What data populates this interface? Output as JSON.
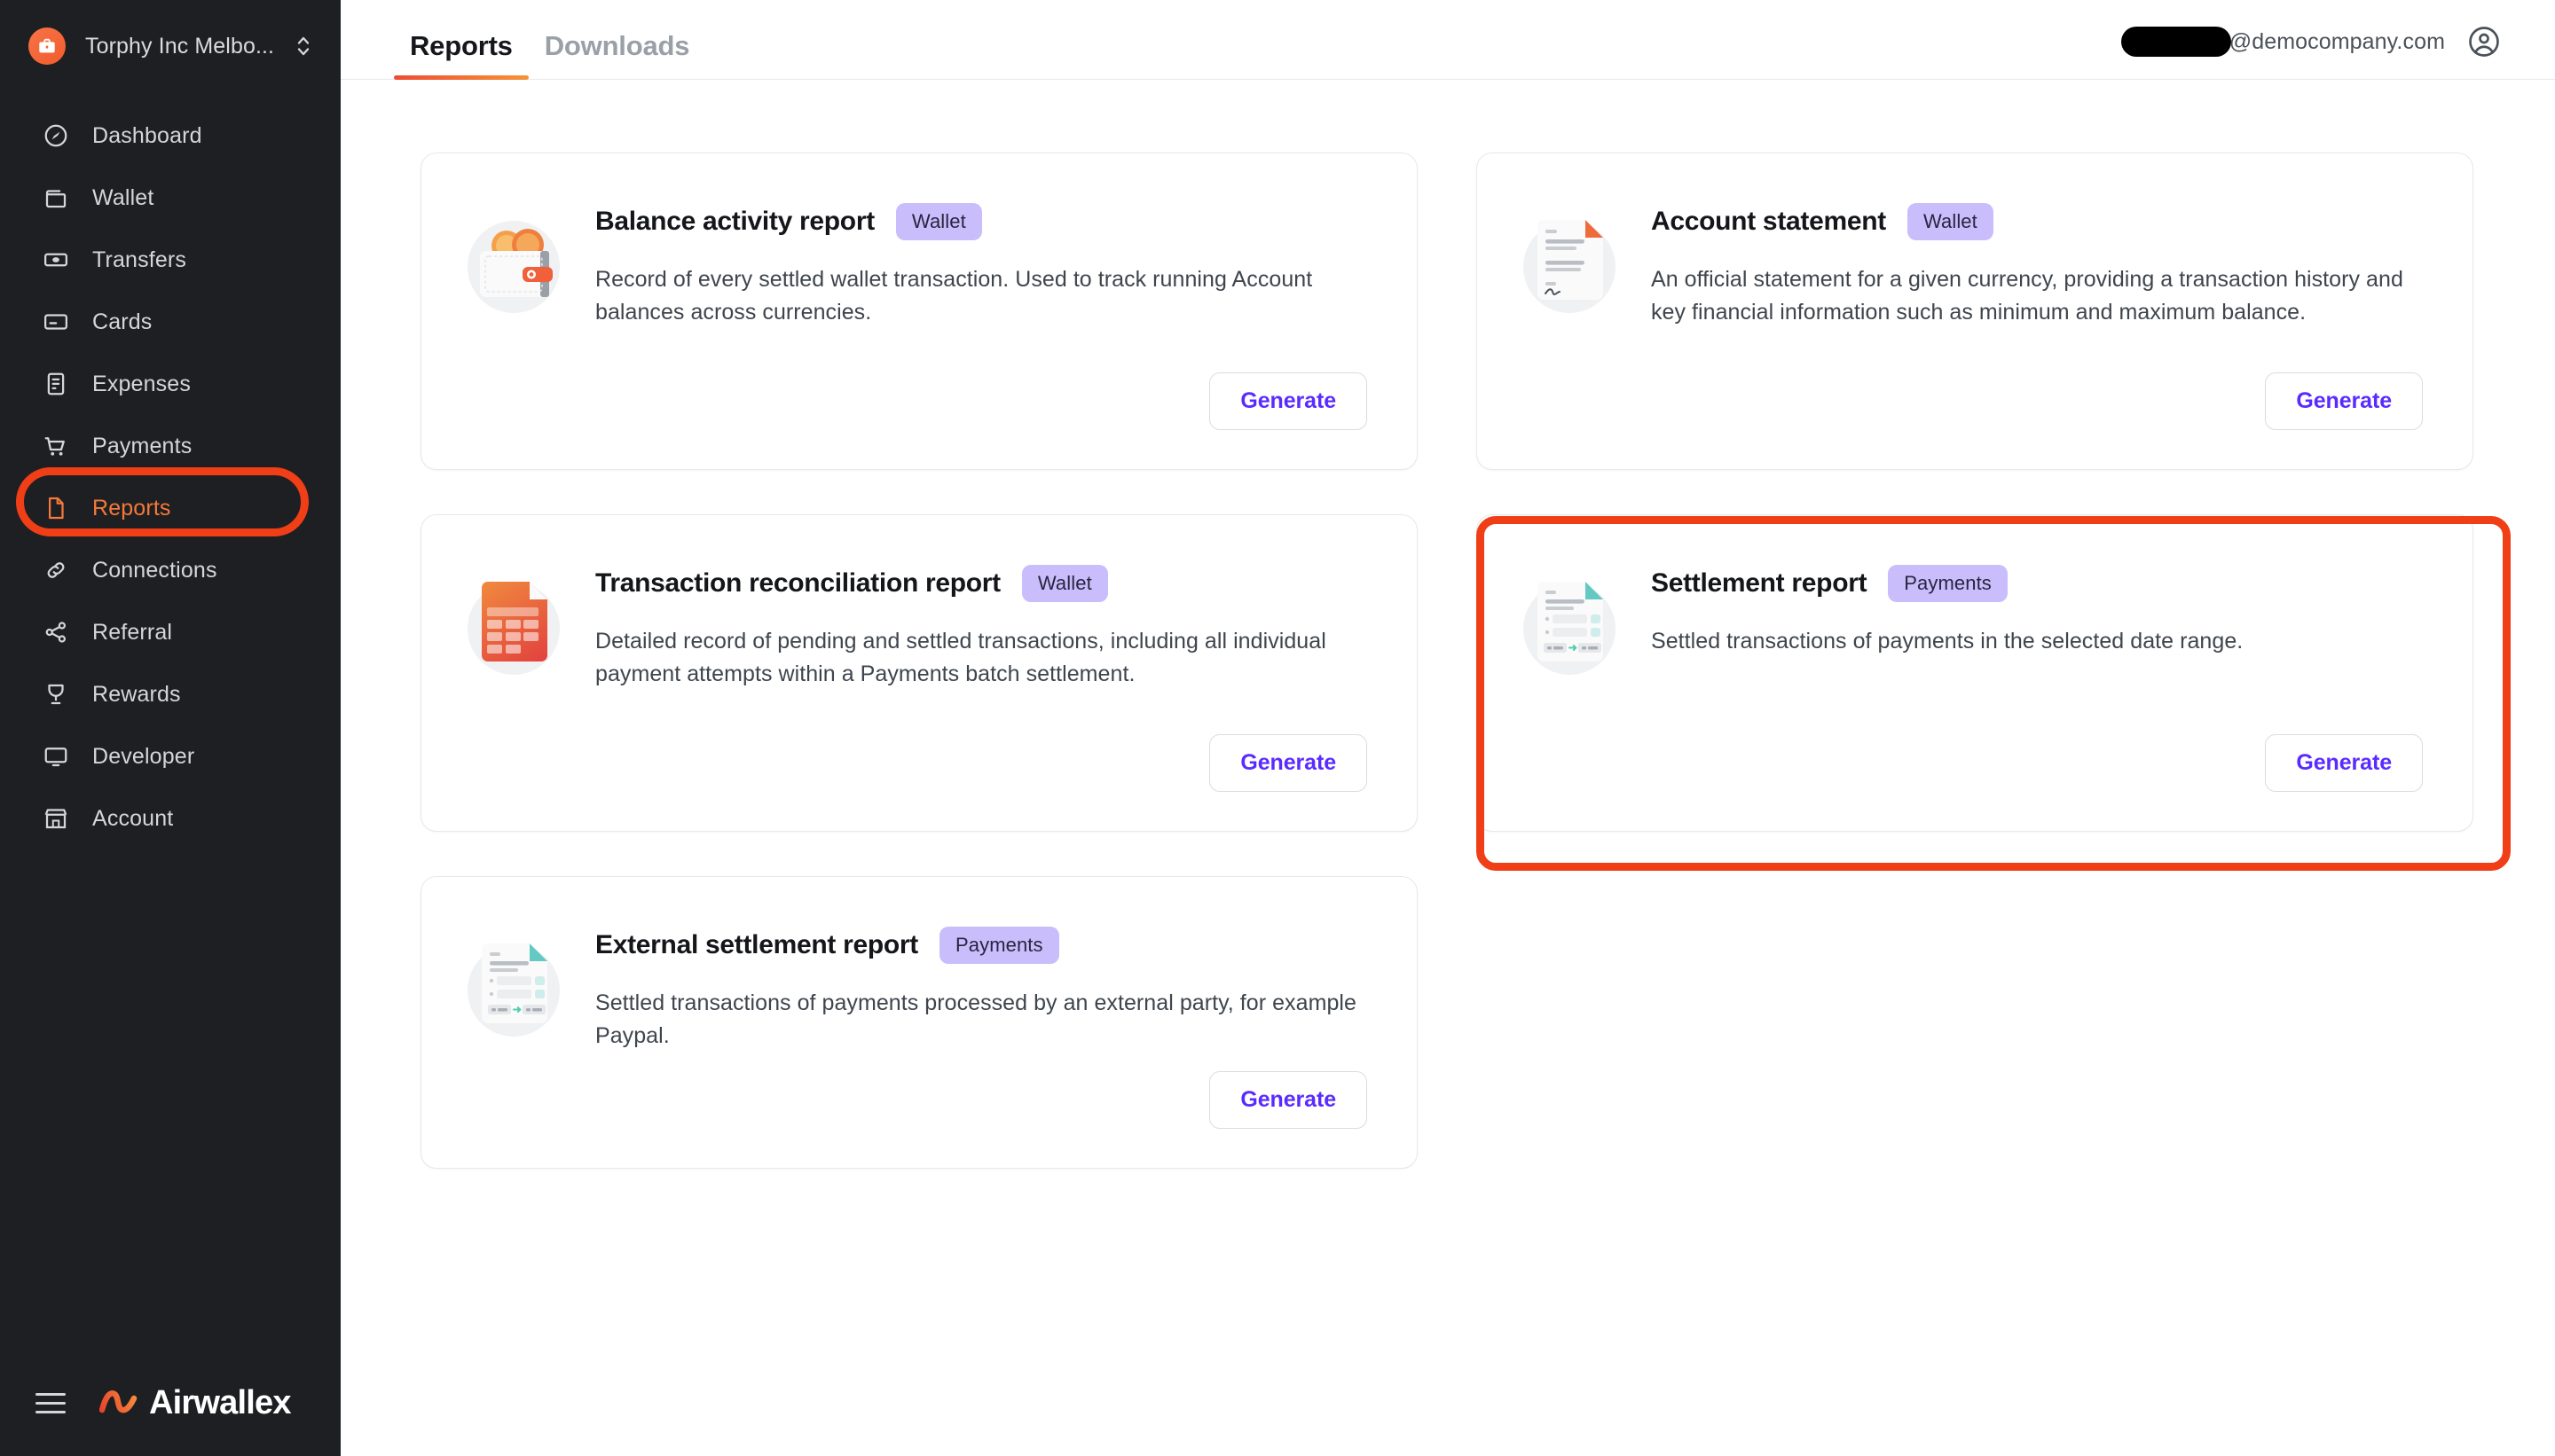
{
  "sidebar": {
    "org": {
      "name": "Torphy Inc Melbo...",
      "avatar_icon": "briefcase-icon",
      "switcher_icon": "chevron-up-down-icon",
      "avatar_color": "#F06A3C"
    },
    "items": [
      {
        "label": "Dashboard",
        "icon": "speedometer-icon",
        "active": false
      },
      {
        "label": "Wallet",
        "icon": "wallet-icon",
        "active": false
      },
      {
        "label": "Transfers",
        "icon": "banknote-icon",
        "active": false
      },
      {
        "label": "Cards",
        "icon": "credit-card-icon",
        "active": false
      },
      {
        "label": "Expenses",
        "icon": "receipt-icon",
        "active": false
      },
      {
        "label": "Payments",
        "icon": "shopping-cart-icon",
        "active": false
      },
      {
        "label": "Reports",
        "icon": "document-icon",
        "active": true
      },
      {
        "label": "Connections",
        "icon": "link-icon",
        "active": false
      },
      {
        "label": "Referral",
        "icon": "share-icon",
        "active": false
      },
      {
        "label": "Rewards",
        "icon": "trophy-icon",
        "active": false
      },
      {
        "label": "Developer",
        "icon": "monitor-icon",
        "active": false
      },
      {
        "label": "Account",
        "icon": "storefront-icon",
        "active": false
      }
    ],
    "footer": {
      "menu_icon": "hamburger-menu-icon",
      "brand_name": "Airwallex",
      "brand_mark_icon": "airwallex-logo-icon"
    },
    "active_color": "#F4793B",
    "background_color": "#1E1F22"
  },
  "header": {
    "tabs": [
      {
        "label": "Reports",
        "active": true
      },
      {
        "label": "Downloads",
        "active": false
      }
    ],
    "user": {
      "email_redacted": true,
      "email_domain": "@democompany.com",
      "avatar_icon": "user-circle-icon"
    }
  },
  "annotations": {
    "color": "#F03E17",
    "targets": [
      "sidebar-item-reports",
      "settlement-report-card"
    ]
  },
  "reports": [
    {
      "id": "balance-activity-report",
      "title": "Balance activity report",
      "badge": "Wallet",
      "description": "Record of every settled wallet transaction. Used to track running Account balances across currencies.",
      "action_label": "Generate",
      "illustration": "wallet-coins-icon",
      "highlighted": false
    },
    {
      "id": "account-statement",
      "title": "Account statement",
      "badge": "Wallet",
      "description": "An official statement for a given currency, providing a transaction history and key financial information such as minimum and maximum balance.",
      "action_label": "Generate",
      "illustration": "document-signature-icon",
      "highlighted": false
    },
    {
      "id": "transaction-reconciliation-report",
      "title": "Transaction reconciliation report",
      "badge": "Wallet",
      "description": "Detailed record of pending and settled transactions, including all individual payment attempts within a Payments batch settlement.",
      "action_label": "Generate",
      "illustration": "document-table-red-icon",
      "highlighted": false
    },
    {
      "id": "settlement-report",
      "title": "Settlement report",
      "badge": "Payments",
      "description": "Settled transactions of payments in the selected date range.",
      "action_label": "Generate",
      "illustration": "document-settlement-icon",
      "highlighted": true
    },
    {
      "id": "external-settlement-report",
      "title": "External settlement report",
      "badge": "Payments",
      "description": "Settled transactions of payments processed by an external party, for example Paypal.",
      "action_label": "Generate",
      "illustration": "document-settlement-icon",
      "highlighted": false
    }
  ],
  "theme": {
    "badge_bg": "#C9BDFB",
    "action_color": "#5A2BFF",
    "tab_underline": "#EE4B33"
  }
}
